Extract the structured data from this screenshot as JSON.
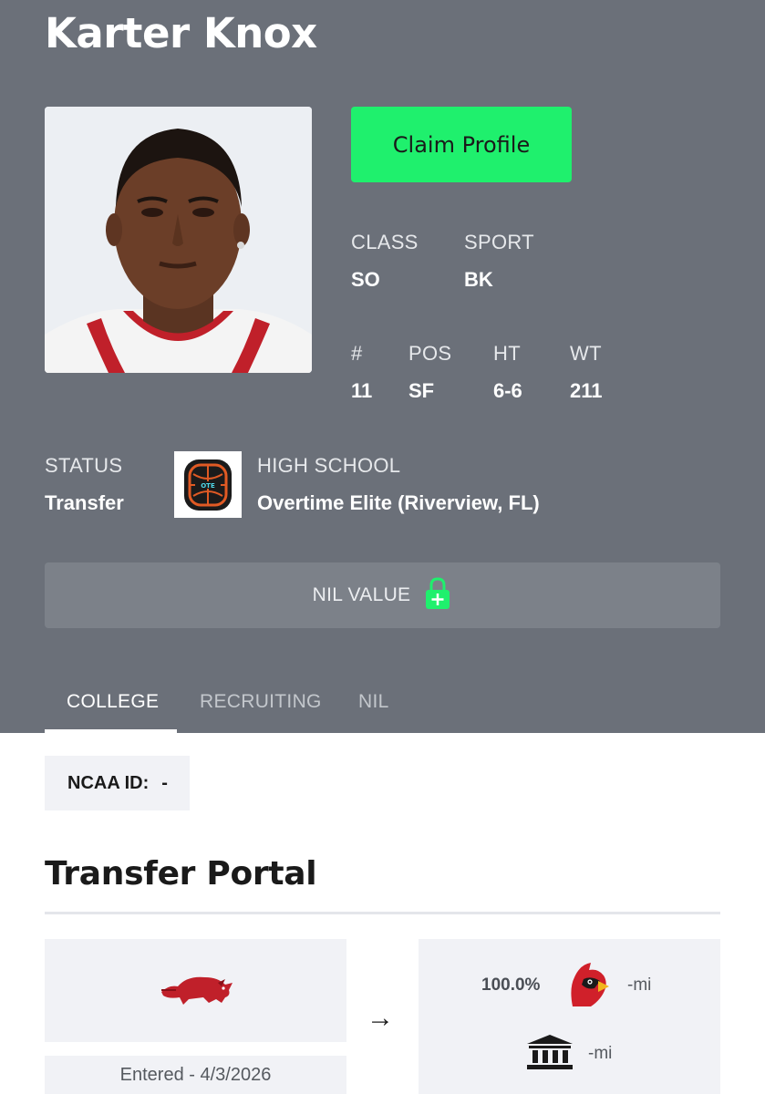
{
  "player": {
    "name": "Karter Knox",
    "photo_alt": "player-photo"
  },
  "actions": {
    "claim_label": "Claim Profile"
  },
  "stats": {
    "class_label": "CLASS",
    "class_value": "SO",
    "sport_label": "SPORT",
    "sport_value": "BK",
    "number_label": "#",
    "number_value": "11",
    "pos_label": "POS",
    "pos_value": "SF",
    "ht_label": "HT",
    "ht_value": "6-6",
    "wt_label": "WT",
    "wt_value": "211"
  },
  "status": {
    "label": "STATUS",
    "value": "Transfer"
  },
  "high_school": {
    "label": "HIGH SCHOOL",
    "value": "Overtime Elite (Riverview, FL)",
    "logo_icon": "ote-logo"
  },
  "nil": {
    "label": "NIL VALUE",
    "icon": "lock-plus-icon",
    "icon_color": "#1ff06d"
  },
  "tabs": [
    {
      "label": "COLLEGE",
      "active": true
    },
    {
      "label": "RECRUITING",
      "active": false
    },
    {
      "label": "NIL",
      "active": false
    }
  ],
  "ncaa": {
    "label": "NCAA ID:",
    "value": "-"
  },
  "transfer_portal": {
    "title": "Transfer Portal",
    "from_logo_icon": "razorback-logo",
    "entered_text": "Entered - 4/3/2026",
    "arrow": "→",
    "destination": {
      "percent": "100.0%",
      "logo_icon": "cardinal-logo",
      "distance": "-mi",
      "building_icon": "institution-icon",
      "building_distance": "-mi"
    }
  },
  "colors": {
    "hero_bg": "#6b7079",
    "accent_green": "#1ff06d",
    "card_bg": "#f1f2f6"
  }
}
